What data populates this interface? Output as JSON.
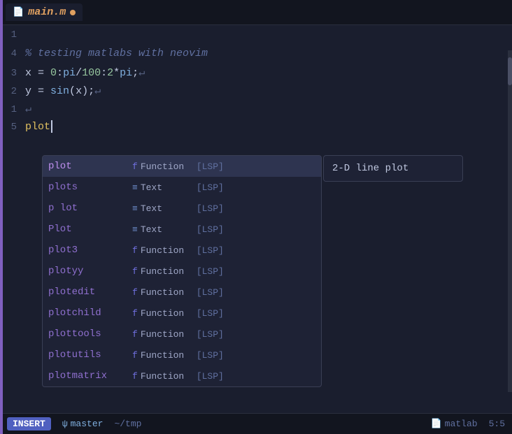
{
  "tab": {
    "icon": "📄",
    "name": "main.m",
    "modified": true
  },
  "lines": [
    {
      "number": "1",
      "tokens": []
    },
    {
      "number": "4",
      "comment": "% testing matlabs with neovim"
    },
    {
      "number": "3",
      "code": "x = 0:pi/100:2*pi;↵"
    },
    {
      "number": "2",
      "code": "y = sin(x);↵"
    },
    {
      "number": "1",
      "code": "↵"
    },
    {
      "number": "5",
      "code": "plot"
    }
  ],
  "autocomplete": {
    "items": [
      {
        "name": "plot",
        "type": "Function",
        "type_icon": "f",
        "source": "[LSP]",
        "selected": true
      },
      {
        "name": "plots",
        "type": "Text",
        "type_icon": "≡",
        "source": "[LSP]",
        "selected": false
      },
      {
        "name": "p lot",
        "type": "Text",
        "type_icon": "≡",
        "source": "[LSP]",
        "selected": false
      },
      {
        "name": "Plot",
        "type": "Text",
        "type_icon": "≡",
        "source": "[LSP]",
        "selected": false
      },
      {
        "name": "plot3",
        "type": "Function",
        "type_icon": "f",
        "source": "[LSP]",
        "selected": false
      },
      {
        "name": "plotyy",
        "type": "Function",
        "type_icon": "f",
        "source": "[LSP]",
        "selected": false
      },
      {
        "name": "plotedit",
        "type": "Function",
        "type_icon": "f",
        "source": "[LSP]",
        "selected": false
      },
      {
        "name": "plotchild",
        "type": "Function",
        "type_icon": "f",
        "source": "[LSP]",
        "selected": false
      },
      {
        "name": "plottools",
        "type": "Function",
        "type_icon": "f",
        "source": "[LSP]",
        "selected": false
      },
      {
        "name": "plotutils",
        "type": "Function",
        "type_icon": "f",
        "source": "[LSP]",
        "selected": false
      },
      {
        "name": "plotmatrix",
        "type": "Function",
        "type_icon": "f",
        "source": "[LSP]",
        "selected": false
      }
    ]
  },
  "doc_popup": {
    "text": "2-D line plot"
  },
  "status_bar": {
    "mode": "INSERT",
    "git_icon": "ψ",
    "branch": "master",
    "path": "~/tmp",
    "file_icon": "📄",
    "filetype": "matlab",
    "position": "5:5"
  }
}
